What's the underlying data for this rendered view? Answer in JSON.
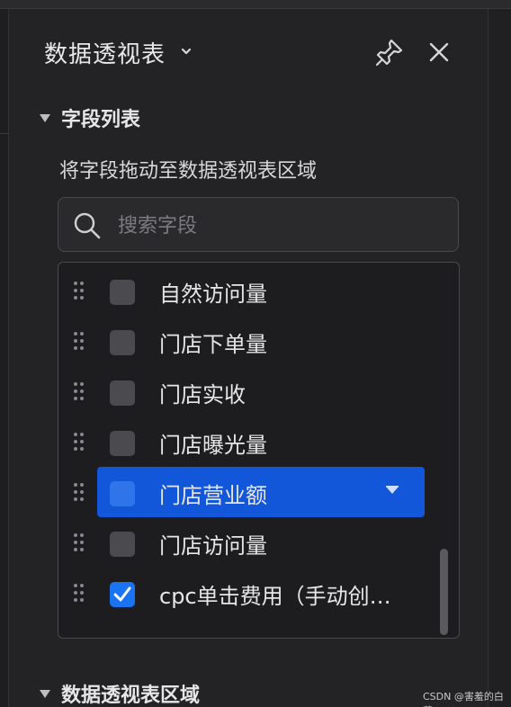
{
  "panel": {
    "title": "数据透视表",
    "pin_icon": "pin-icon",
    "close_icon": "close-icon"
  },
  "field_list": {
    "section_label": "字段列表",
    "hint": "将字段拖动至数据透视表区域",
    "search": {
      "placeholder": "搜索字段",
      "value": ""
    },
    "items": [
      {
        "label": "自然访问量",
        "checked": false,
        "active": false
      },
      {
        "label": "门店下单量",
        "checked": false,
        "active": false
      },
      {
        "label": "门店实收",
        "checked": false,
        "active": false
      },
      {
        "label": "门店曝光量",
        "checked": false,
        "active": false
      },
      {
        "label": "门店营业额",
        "checked": false,
        "active": true
      },
      {
        "label": "门店访问量",
        "checked": false,
        "active": false
      },
      {
        "label": "cpc单击费用（手动创…",
        "checked": true,
        "active": false
      }
    ]
  },
  "pivot_area": {
    "section_label": "数据透视表区域"
  },
  "watermark": "CSDN @害羞的白菜",
  "colors": {
    "accent": "#1257d9",
    "checkbox_checked": "#1a73f0",
    "background": "#232325"
  }
}
